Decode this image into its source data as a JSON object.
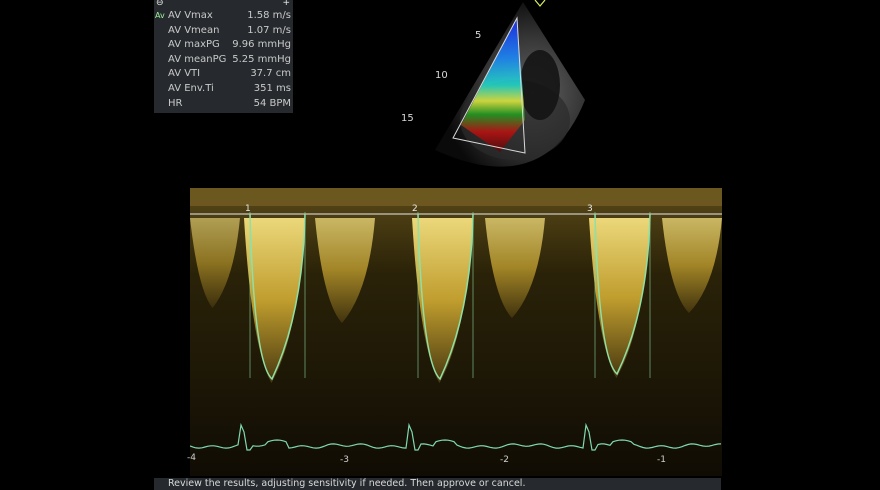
{
  "measurements": {
    "tag": "Av",
    "rows": [
      {
        "label": "AV Vmax",
        "value": "1.58 m/s"
      },
      {
        "label": "AV Vmean",
        "value": "1.07 m/s"
      },
      {
        "label": "AV maxPG",
        "value": "9.96 mmHg"
      },
      {
        "label": "AV meanPG",
        "value": "5.25 mmHg"
      },
      {
        "label": "AV VTI",
        "value": "37.7 cm"
      },
      {
        "label": "AV Env.Ti",
        "value": "351 ms"
      },
      {
        "label": "HR",
        "value": "54 BPM"
      }
    ]
  },
  "echo": {
    "depth_labels": [
      "5",
      "10",
      "15"
    ],
    "corner_mark": "V"
  },
  "doppler": {
    "beat_markers": [
      "1",
      "2",
      "3"
    ],
    "time_ticks": [
      "-4",
      "-3",
      "-2",
      "-1"
    ],
    "trace_color": "#8fe0a6",
    "spectrum_color": "#e8d060",
    "ecg_color": "#7fd8b0"
  },
  "status": {
    "message": "Review the results, adjusting sensitivity if needed. Then approve or cancel."
  }
}
